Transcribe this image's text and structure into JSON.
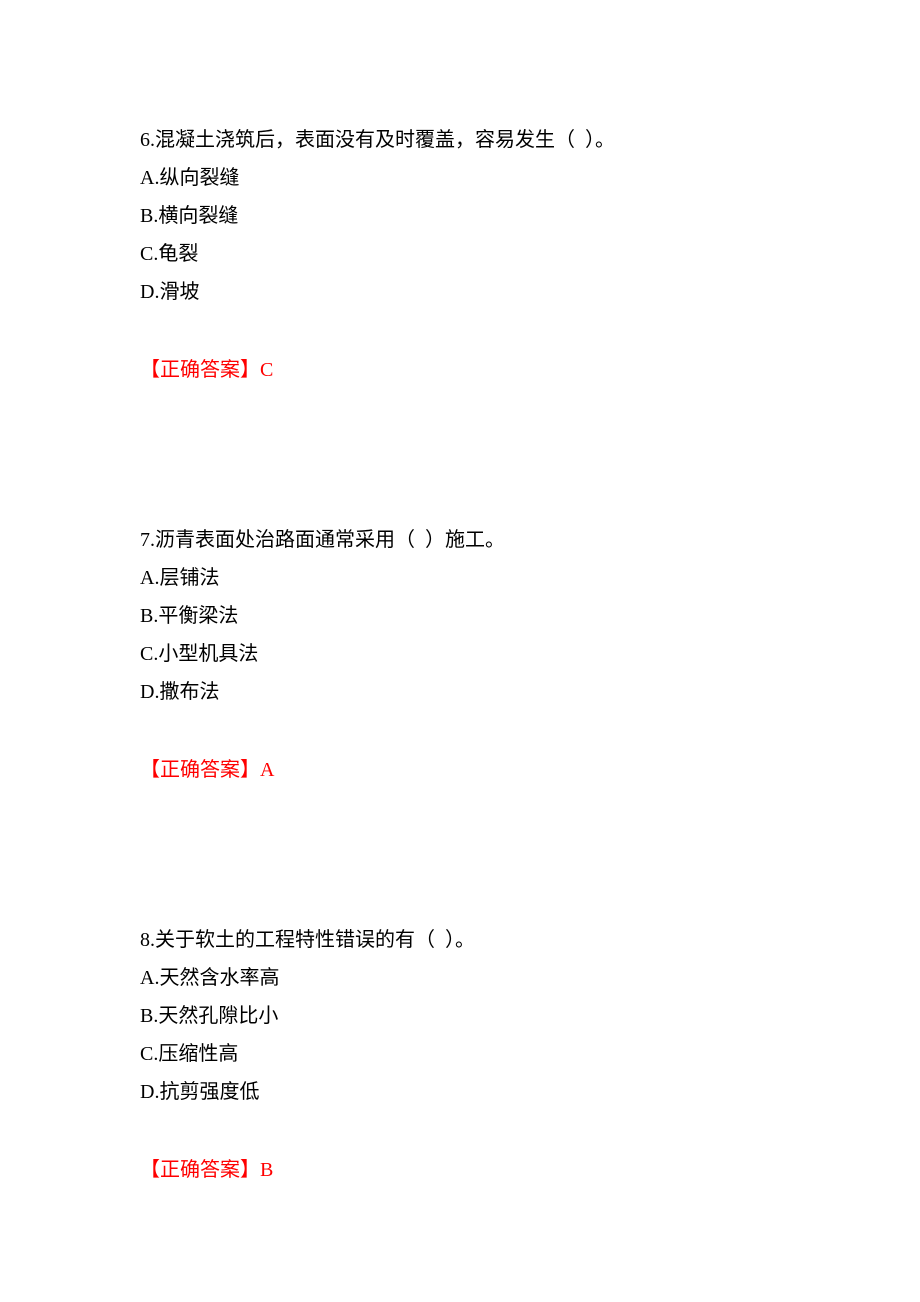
{
  "questions": [
    {
      "number": "6.",
      "stem": "混凝土浇筑后，表面没有及时覆盖，容易发生（  ）。",
      "options": [
        "A.纵向裂缝",
        "B.横向裂缝",
        "C.龟裂",
        "D.滑坡"
      ],
      "answer_label": "【正确答案】",
      "answer_value": "C"
    },
    {
      "number": "7.",
      "stem": "沥青表面处治路面通常采用（  ）施工。",
      "options": [
        "A.层铺法",
        "B.平衡梁法",
        "C.小型机具法",
        "D.撒布法"
      ],
      "answer_label": "【正确答案】",
      "answer_value": "A"
    },
    {
      "number": "8.",
      "stem": "关于软土的工程特性错误的有（  ）。",
      "options": [
        "A.天然含水率高",
        "B.天然孔隙比小",
        "C.压缩性高",
        "D.抗剪强度低"
      ],
      "answer_label": "【正确答案】",
      "answer_value": "B"
    }
  ]
}
